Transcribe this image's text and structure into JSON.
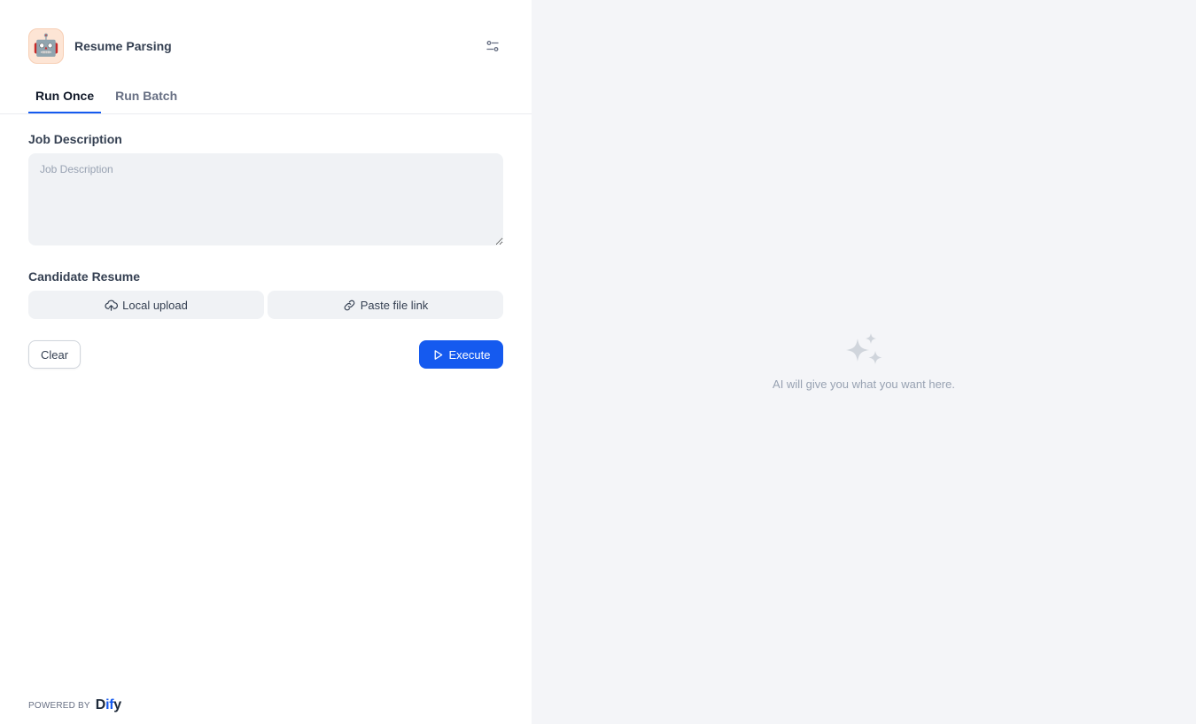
{
  "app": {
    "title": "Resume Parsing",
    "icon": "robot-emoji",
    "icon_glyph": "🤖"
  },
  "header": {
    "settings_icon": "sliders-icon"
  },
  "tabs": [
    {
      "label": "Run Once",
      "active": true
    },
    {
      "label": "Run Batch",
      "active": false
    }
  ],
  "form": {
    "job_description": {
      "label": "Job Description",
      "placeholder": "Job Description",
      "value": ""
    },
    "candidate_resume": {
      "label": "Candidate Resume",
      "local_upload_label": "Local upload",
      "paste_link_label": "Paste file link"
    }
  },
  "actions": {
    "clear_label": "Clear",
    "execute_label": "Execute"
  },
  "footer": {
    "powered_by": "POWERED BY",
    "brand_d": "D",
    "brand_if": "if",
    "brand_y": "y"
  },
  "result": {
    "empty_text": "AI will give you what you want here."
  },
  "colors": {
    "accent": "#155aef",
    "panel_bg": "#f4f5f8",
    "text_primary": "#101828",
    "text_muted": "#98a2b2"
  }
}
